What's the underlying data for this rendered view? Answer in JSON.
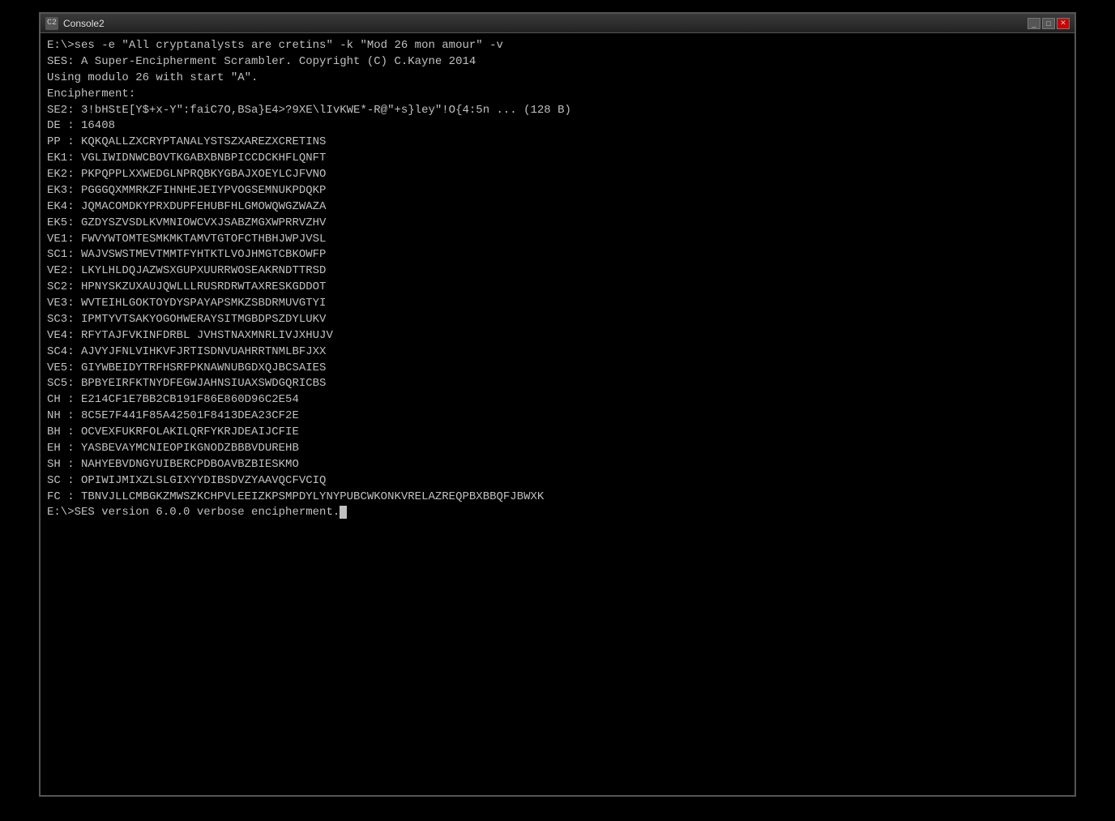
{
  "window": {
    "title": "Console2",
    "titlebar_icon": "C2"
  },
  "terminal": {
    "lines": [
      "E:\\>ses -e \"All cryptanalysts are cretins\" -k \"Mod 26 mon amour\" -v",
      "SES: A Super-Encipherment Scrambler. Copyright (C) C.Kayne 2014",
      "Using modulo 26 with start \"A\".",
      "Encipherment:",
      "SE2: 3!bHStE[Y$+x-Y\":faiC7O,BSa}E4>?9XE\\lIvKWE*-R@\"+s}ley\"!O{4:5n ... (128 B)",
      "DE : 16408",
      "PP : KQKQALLZXCRYPTANALYSTSZXAREZXCRETINS",
      "EK1: VGLIWIDNWCBOVTKGABXBNBPICCDCKHFLQNFT",
      "EK2: PKPQPPLXXWEDGLNPRQBKYGBAJXOEYLCJFVNO",
      "EK3: PGGGQXMMRKZFIHNHEJEIYPVOGSEMNUKPDQKP",
      "EK4: JQMACOMDKYPRXDUPFEHUBFHLGMOWQWGZWAZA",
      "EK5: GZDYSZVSDLKVMNIOWCVXJSABZMGXWPRRVZHV",
      "VE1: FWVYWTOMTESMKMKTAMVTGTOFCTHBHJWPJVSL",
      "SC1: WAJVSWSTMEVTMMTFYHTKTLVOJHMGTCBKOWFP",
      "VE2: LKYLHLDQJAZWSXGUPXUURRWOSEAKRNDTTRSD",
      "SC2: HPNYSKZUXAUJQWLLLRUSRDRWTAXRESKGDDOT",
      "VE3: WVTEIHLGOKTOYDYSPAYAPSMKZSBDRMUVGTYI",
      "SC3: IPMTYVTSAKYOGOHWERAYSITMGBDPSZDYLUKV",
      "VE4: RFYTAJFVKINFDRBL JVHSTNAXMNRLIVJXHUJV",
      "SC4: AJVYJFNLVIHKVFJRTISDNVUAHRRTNMLBFJXX",
      "VE5: GIYWBEIDYTRFHSRFPKNAWNUBGDXQJBCSAIES",
      "SC5: BPBYEIRFKTNYDFEGWJAHNSIUAXSWDGQRICBS",
      "CH : E214CF1E7BB2CB191F86E860D96C2E54",
      "NH : 8C5E7F441F85A42501F8413DEA23CF2E",
      "BH : OCVEXFUKRFOLAKILQRFYKRJDEAIJCFIE",
      "EH : YASBEVAYMCNIEOPIKGNODZBBBVDUREHB",
      "SH : NAHYEBVDNGYUIBERCPDBOAVBZBIESKMO",
      "SC : OPIWIJMIXZLSLGIXYYDIBSDVZYAAVQCFVCIQ",
      "FC : TBNVJLLCMBGKZMWSZKCHPVLEEIZKPSMPDYLYNYPUBCWKONKVRELAZREQPBXBBQFJBWXK",
      "",
      "E:\\>SES version 6.0.0 verbose encipherment.—"
    ]
  }
}
